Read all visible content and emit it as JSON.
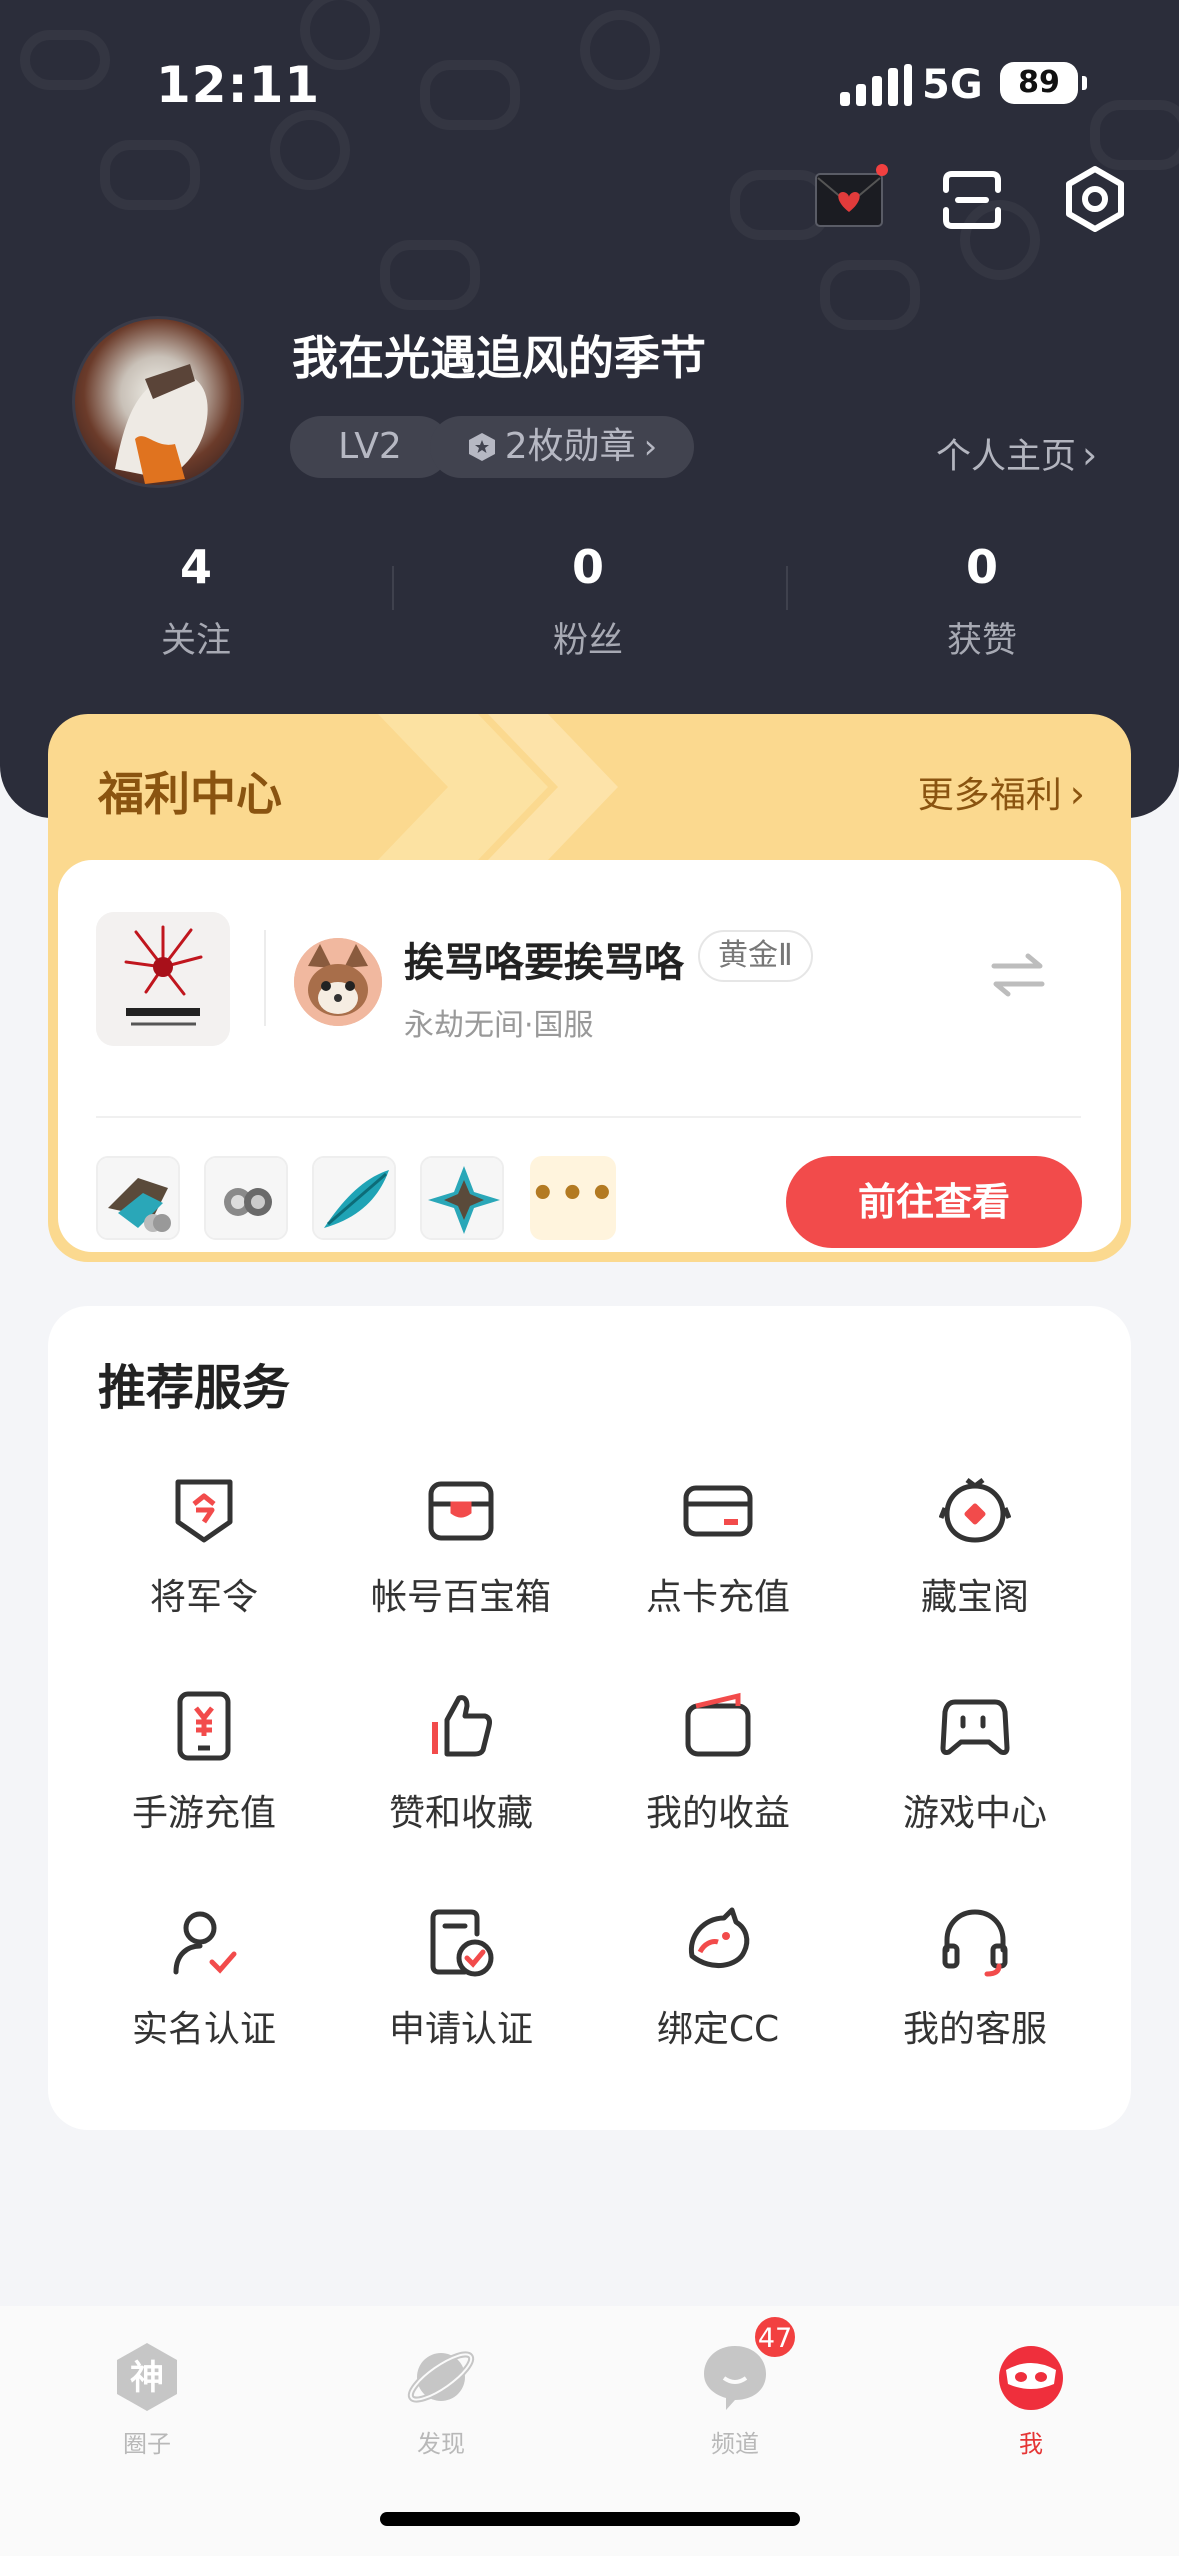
{
  "status_bar": {
    "time": "12:11",
    "network": "5G",
    "battery": "89"
  },
  "header": {
    "icons": [
      "mail-icon",
      "scan-icon",
      "settings-icon"
    ],
    "username": "我在光遇追风的季节",
    "level": "LV2",
    "medals": "2枚勋章",
    "profile_link": "个人主页",
    "stats": [
      {
        "value": "4",
        "label": "关注"
      },
      {
        "value": "0",
        "label": "粉丝"
      },
      {
        "value": "0",
        "label": "获赞"
      }
    ]
  },
  "welfare": {
    "title": "福利中心",
    "more": "更多福利",
    "account_name": "挨骂咯要挨骂咯",
    "rank": "黄金Ⅱ",
    "server": "永劫无间·国服",
    "more_items": "•••",
    "go_button": "前往查看"
  },
  "services": {
    "title": "推荐服务",
    "items": [
      {
        "label": "将军令",
        "icon": "command-token-icon"
      },
      {
        "label": "帐号百宝箱",
        "icon": "treasure-box-icon"
      },
      {
        "label": "点卡充值",
        "icon": "card-recharge-icon"
      },
      {
        "label": "藏宝阁",
        "icon": "treasure-pavilion-icon"
      },
      {
        "label": "手游充值",
        "icon": "mobile-recharge-icon"
      },
      {
        "label": "赞和收藏",
        "icon": "thumbs-up-icon"
      },
      {
        "label": "我的收益",
        "icon": "wallet-icon"
      },
      {
        "label": "游戏中心",
        "icon": "gamepad-icon"
      },
      {
        "label": "实名认证",
        "icon": "user-verify-icon"
      },
      {
        "label": "申请认证",
        "icon": "apply-verify-icon"
      },
      {
        "label": "绑定CC",
        "icon": "bind-cc-icon"
      },
      {
        "label": "我的客服",
        "icon": "headset-icon"
      }
    ]
  },
  "tabbar": {
    "tabs": [
      {
        "label": "圈子",
        "glyph": "神"
      },
      {
        "label": "发现"
      },
      {
        "label": "频道",
        "badge": "47"
      },
      {
        "label": "我"
      }
    ]
  },
  "colors": {
    "accent": "#f24b4b",
    "header_bg": "#2b2d3a",
    "welfare_bg": "#fbd98f",
    "welfare_text": "#8a5410"
  }
}
